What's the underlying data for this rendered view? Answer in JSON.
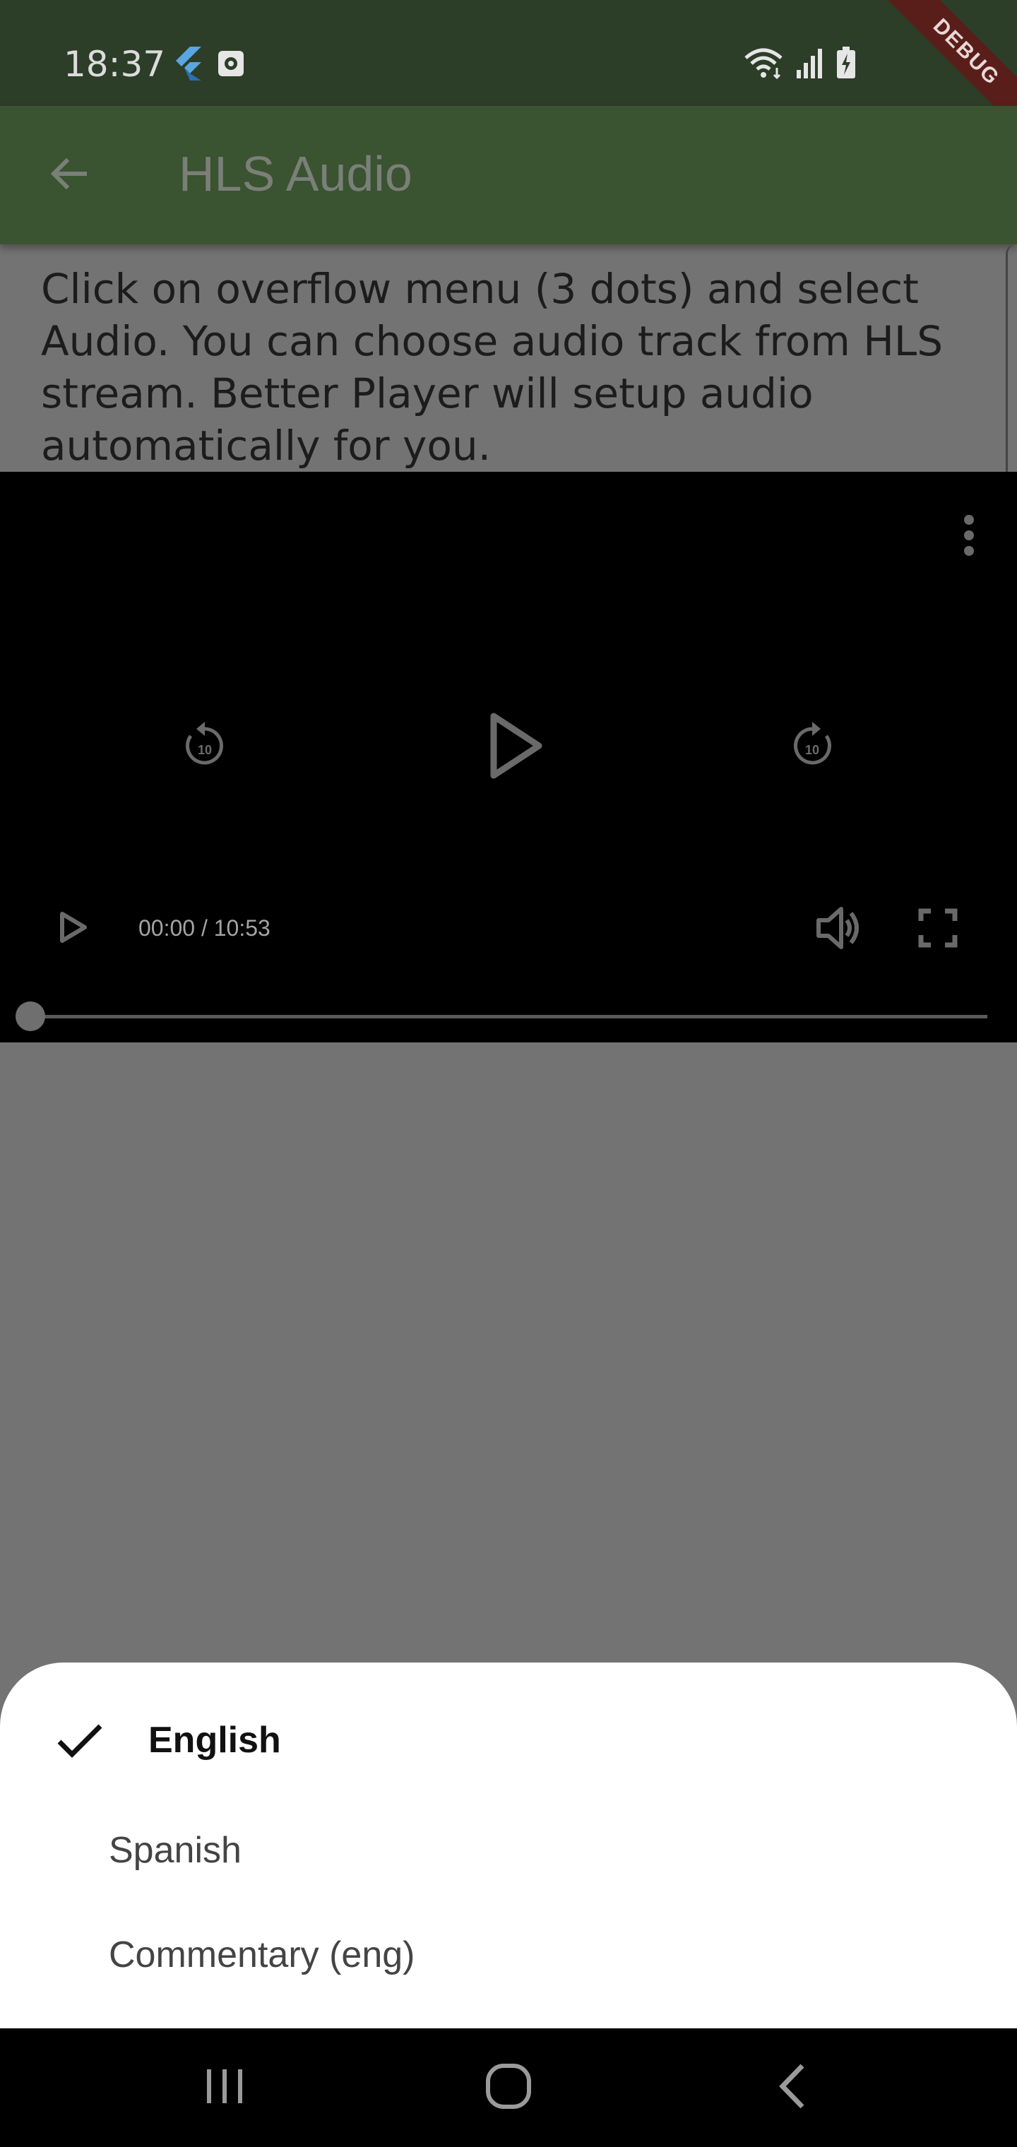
{
  "status_bar": {
    "time": "18:37",
    "icons": [
      "flutter-icon",
      "screen-recorder-icon",
      "wifi-icon",
      "signal-icon",
      "battery-charging-icon"
    ]
  },
  "debug_banner": {
    "label": "DEBUG"
  },
  "app_bar": {
    "title": "HLS Audio",
    "back_icon": "arrow-left-icon"
  },
  "description": "Click on overflow menu (3 dots) and select Audio. You can choose audio track from HLS stream. Better Player will setup audio automatically for you.",
  "player": {
    "time_display": "00:00 / 10:53",
    "rewind_label": "10",
    "forward_label": "10",
    "progress": 0,
    "icons": [
      "more-vert-icon",
      "replay-10-icon",
      "play-icon",
      "forward-10-icon",
      "volume-icon",
      "fullscreen-icon"
    ]
  },
  "audio_sheet": {
    "tracks": [
      {
        "label": "English",
        "selected": true
      },
      {
        "label": "Spanish",
        "selected": false
      },
      {
        "label": "Commentary (eng)",
        "selected": false
      }
    ]
  },
  "nav_bar": {
    "icons": [
      "recents-icon",
      "home-icon",
      "back-icon"
    ]
  },
  "colors": {
    "status_bar": "#2c3d28",
    "app_bar": "#3a5330",
    "scrim": "#737373",
    "sheet": "#ffffff",
    "debug_banner": "#5a1e1a"
  }
}
